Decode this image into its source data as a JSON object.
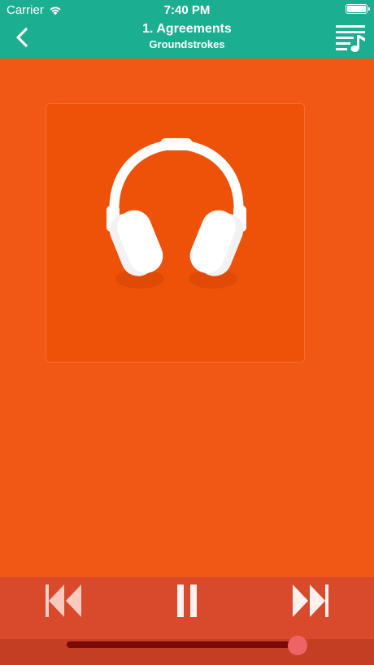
{
  "status_bar": {
    "carrier": "Carrier",
    "time": "7:40 PM",
    "wifi_icon": "wifi-icon",
    "battery_icon": "battery-icon"
  },
  "nav": {
    "back_icon": "chevron-left-icon",
    "title": "1. Agreements",
    "subtitle": "Groundstrokes",
    "playlist_icon": "playlist-icon"
  },
  "artwork": {
    "icon": "headphones-icon"
  },
  "controls": {
    "rewind_icon": "rewind-icon",
    "pause_icon": "pause-icon",
    "forward_icon": "fast-forward-icon",
    "progress": 0.99
  },
  "colors": {
    "header": "#1BAE90",
    "background": "#F15815",
    "controls": "#D94A2D",
    "progress_track": "#8B0E0E",
    "progress_thumb": "#EE6464"
  }
}
